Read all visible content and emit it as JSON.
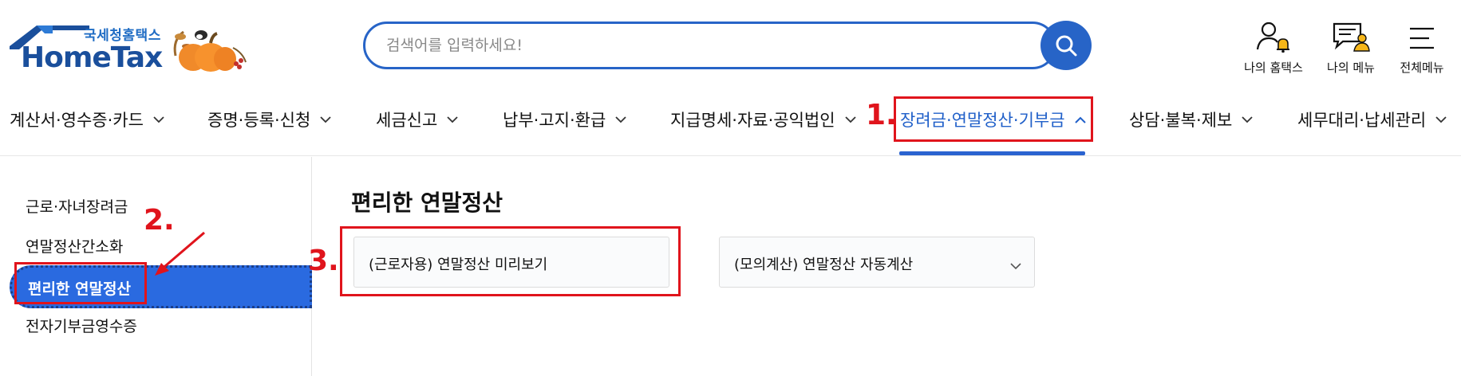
{
  "header": {
    "logo_sub": "국세청홈택스",
    "logo_main": "HomeTax",
    "search": {
      "placeholder": "검색어를 입력하세요!"
    },
    "utilities": [
      {
        "label": "나의 홈택스",
        "icon": "user-bell-icon"
      },
      {
        "label": "나의 메뉴",
        "icon": "list-user-icon"
      },
      {
        "label": "전체메뉴",
        "icon": "hamburger-icon"
      }
    ]
  },
  "gnb": {
    "items": [
      {
        "label": "계산서·영수증·카드",
        "expanded": false
      },
      {
        "label": "증명·등록·신청",
        "expanded": false
      },
      {
        "label": "세금신고",
        "expanded": false
      },
      {
        "label": "납부·고지·환급",
        "expanded": false
      },
      {
        "label": "지급명세·자료·공익법인",
        "expanded": false
      },
      {
        "label": "장려금·연말정산·기부금",
        "expanded": true
      },
      {
        "label": "상담·불복·제보",
        "expanded": false
      },
      {
        "label": "세무대리·납세관리",
        "expanded": false
      }
    ],
    "accent_color": "#2a63d0"
  },
  "sidebar": {
    "items": [
      {
        "label": "근로·자녀장려금"
      },
      {
        "label": "연말정산간소화"
      },
      {
        "label": "편리한 연말정산",
        "active": true
      },
      {
        "label": "전자기부금영수증"
      }
    ]
  },
  "main": {
    "title": "편리한 연말정산",
    "cards": [
      {
        "label": "(근로자용) 연말정산 미리보기"
      },
      {
        "label": "(모의계산) 연말정산 자동계산",
        "has_dropdown": true
      }
    ]
  },
  "annotations": {
    "step1": "1.",
    "step2": "2.",
    "step3": "3.",
    "color": "#e0141c"
  }
}
